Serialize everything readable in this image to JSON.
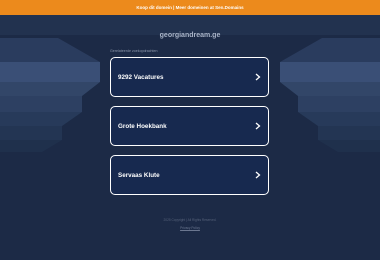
{
  "topbar": {
    "text": "Koop dit domein | Meer domeinen at Sen.Domains"
  },
  "domain": "georgiandream.ge",
  "related_label": "Gerelateerde zoekopdrachten",
  "links": [
    {
      "label": "9292 Vacatures"
    },
    {
      "label": "Grote Hoekbank"
    },
    {
      "label": "Servaas Klute"
    }
  ],
  "footer": {
    "copyright": "2025 Copyright | All Rights Reserved.",
    "privacy": "Privacy Policy"
  },
  "colors": {
    "background": "#1c2a46",
    "topbar": "#ec8a1c",
    "card_fill": "#17294f",
    "card_border": "#ffffff"
  }
}
